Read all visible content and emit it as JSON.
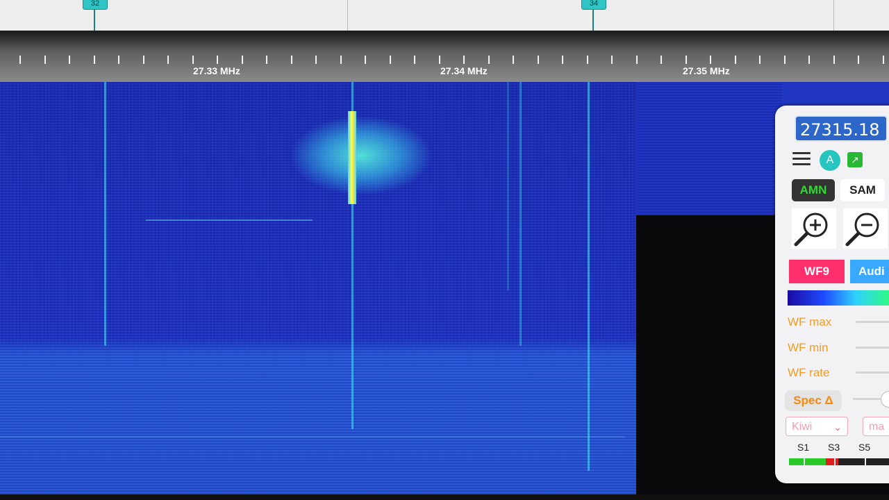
{
  "markers": [
    {
      "id": "m-left",
      "label": "32"
    },
    {
      "id": "m-right",
      "label": "34"
    }
  ],
  "scale": {
    "labels": [
      "27.33 MHz",
      "27.34 MHz",
      "27.35 MHz"
    ]
  },
  "panel": {
    "frequency_value": "27315.18",
    "mode_buttons": [
      "AMN",
      "SAM"
    ],
    "waterfall_buttons": [
      "WF9",
      "Audi"
    ],
    "sliders": [
      "WF max",
      "WF min",
      "WF rate"
    ],
    "spec_button": "Spec Δ",
    "select_kiwi": "Kiwi",
    "select_ma": "ma",
    "smeter_labels": [
      "S1",
      "S3",
      "S5"
    ],
    "smeter_level": 0.47
  },
  "colors": {
    "accent_amn": "#2edb2e",
    "wf9": "#ff2f6e",
    "audio": "#38a9ff",
    "slider_label": "#f59c1f"
  },
  "icons": [
    "menu-icon",
    "a-icon",
    "external-link-icon",
    "zoom-in-icon",
    "zoom-out-icon",
    "chevron-down-icon"
  ]
}
